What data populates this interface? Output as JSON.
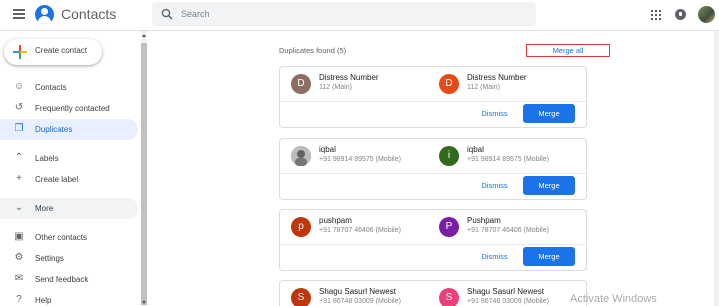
{
  "header": {
    "app_title": "Contacts",
    "search_placeholder": "Search",
    "icons": [
      "menu-icon",
      "contacts-logo-icon",
      "search-icon",
      "apps-icon",
      "notifications-icon"
    ]
  },
  "sidebar": {
    "create_label": "Create contact",
    "items": [
      {
        "label": "Contacts",
        "icon": "person-icon"
      },
      {
        "label": "Frequently contacted",
        "icon": "history-icon"
      },
      {
        "label": "Duplicates",
        "icon": "duplicates-icon",
        "active": true
      },
      {
        "label": "Labels",
        "icon": "chevron-up-icon"
      },
      {
        "label": "Create label",
        "icon": "plus-icon"
      },
      {
        "label": "More",
        "icon": "chevron-down-icon"
      },
      {
        "label": "Other contacts",
        "icon": "contacts-box-icon"
      },
      {
        "label": "Settings",
        "icon": "gear-icon"
      },
      {
        "label": "Send feedback",
        "icon": "feedback-icon"
      },
      {
        "label": "Help",
        "icon": "help-icon"
      }
    ]
  },
  "main": {
    "duplicates_found": "Duplicates found (5)",
    "merge_all_label": "Merge all",
    "dismiss_label": "Dismiss",
    "merge_label": "Merge",
    "cards": [
      {
        "contacts": [
          {
            "initial": "D",
            "name": "Distress Number",
            "detail": "112 (Main)",
            "color": "#8d6e63"
          },
          {
            "initial": "D",
            "name": "Distress Number",
            "detail": "112 (Main)",
            "color": "#e64a19"
          }
        ]
      },
      {
        "contacts": [
          {
            "initial": "",
            "name": "iqbal",
            "detail": "+91 98914 89575 (Mobile)",
            "color": "#9e9e9e",
            "photo": true
          },
          {
            "initial": "i",
            "name": "iqbal",
            "detail": "+91 98914 89575 (Mobile)",
            "color": "#33691e"
          }
        ]
      },
      {
        "contacts": [
          {
            "initial": "p",
            "name": "pushpam",
            "detail": "+91 78707 46406 (Mobile)",
            "color": "#bf360c"
          },
          {
            "initial": "P",
            "name": "Pushpam",
            "detail": "+91 78707 46406 (Mobile)",
            "color": "#7b1fa2"
          }
        ]
      },
      {
        "contacts": [
          {
            "initial": "S",
            "name": "Shagu Sasurl Newest",
            "detail": "+91 86748 03009 (Mobile)",
            "color": "#bf360c"
          },
          {
            "initial": "S",
            "name": "Shagu Sasurl Newest",
            "detail": "+91 86748 03009 (Mobile)",
            "color": "#ec407a"
          }
        ]
      }
    ]
  },
  "watermark": "Activate Windows"
}
